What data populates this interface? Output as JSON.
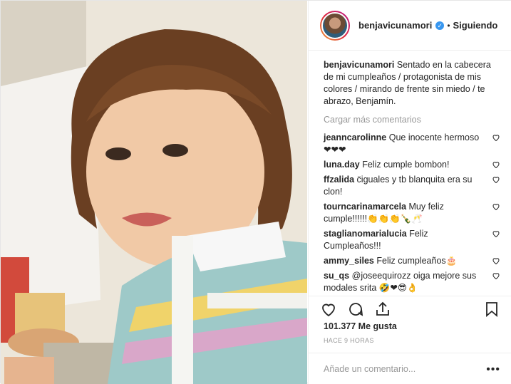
{
  "header": {
    "username": "benjavicunamori",
    "separator": "•",
    "follow_status": "Siguiendo",
    "verified_mark": "✓"
  },
  "caption": {
    "username": "benjavicunamori",
    "text": "Sentado en la cabecera de mi cumpleaños / protagonista de mis colores / mirando de frente sin miedo / te abrazo, Benjamín."
  },
  "load_more": "Cargar más comentarios",
  "comments": [
    {
      "user": "jeanncarolinne",
      "text": "Que inocente hermoso ❤❤❤"
    },
    {
      "user": "luna.day",
      "text": "Feliz cumple bombon!"
    },
    {
      "user": "ffzalida",
      "text": "c̈iguales y tb blanquita era su clon!"
    },
    {
      "user": "tourncarinamarcela",
      "text": "Muy feliz cumple!!!!!!👏👏👏🍾🥂"
    },
    {
      "user": "staglianomarialucia",
      "text": "Feliz Cumpleaños!!!"
    },
    {
      "user": "ammy_siles",
      "text": "Feliz cumpleaños🎂"
    },
    {
      "user": "su_qs",
      "text": "@joseequirozz oiga mejore sus modales srita 🤣❤😎👌"
    }
  ],
  "likes": "101.377 Me gusta",
  "time": "HACE 9 HORAS",
  "add_comment": {
    "placeholder": "Añade un comentario..."
  },
  "more_label": "•••",
  "colors": {
    "link": "#003569",
    "accent": "#3897f0",
    "muted": "#999999"
  },
  "icons": [
    "heart-icon",
    "comment-icon",
    "share-icon",
    "bookmark-icon",
    "verified-icon"
  ]
}
